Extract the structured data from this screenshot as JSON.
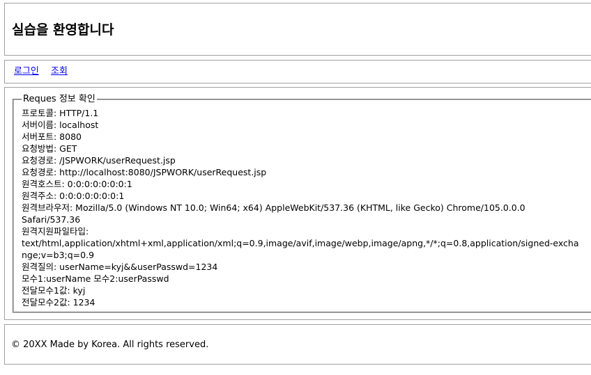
{
  "header": {
    "title": "실습을 환영합니다"
  },
  "nav": {
    "login": "로그인",
    "view": "조회"
  },
  "request_info": {
    "legend": "Reques 정보 확인",
    "lines": [
      "프로토콜: HTTP/1.1",
      "서버이름: localhost",
      "서버포트: 8080",
      "요청방법: GET",
      "요청경로: /JSPWORK/userRequest.jsp",
      "요청경로: http://localhost:8080/JSPWORK/userRequest.jsp",
      "원격호스트: 0:0:0:0:0:0:0:1",
      "원격주소: 0:0:0:0:0:0:0:1",
      "원격브라우저: Mozilla/5.0 (Windows NT 10.0; Win64; x64) AppleWebKit/537.36 (KHTML, like Gecko) Chrome/105.0.0.0 Safari/537.36",
      "원격지원파일타입:",
      "text/html,application/xhtml+xml,application/xml;q=0.9,image/avif,image/webp,image/apng,*/*;q=0.8,application/signed-exchange;v=b3;q=0.9",
      "원격질의: userName=kyj&&userPasswd=1234",
      "모수1:userName 모수2:userPasswd",
      "전달모수1값: kyj",
      "전달모수2값: 1234"
    ]
  },
  "footer": {
    "copyright": "© 20XX Made by Korea. All rights reserved."
  }
}
